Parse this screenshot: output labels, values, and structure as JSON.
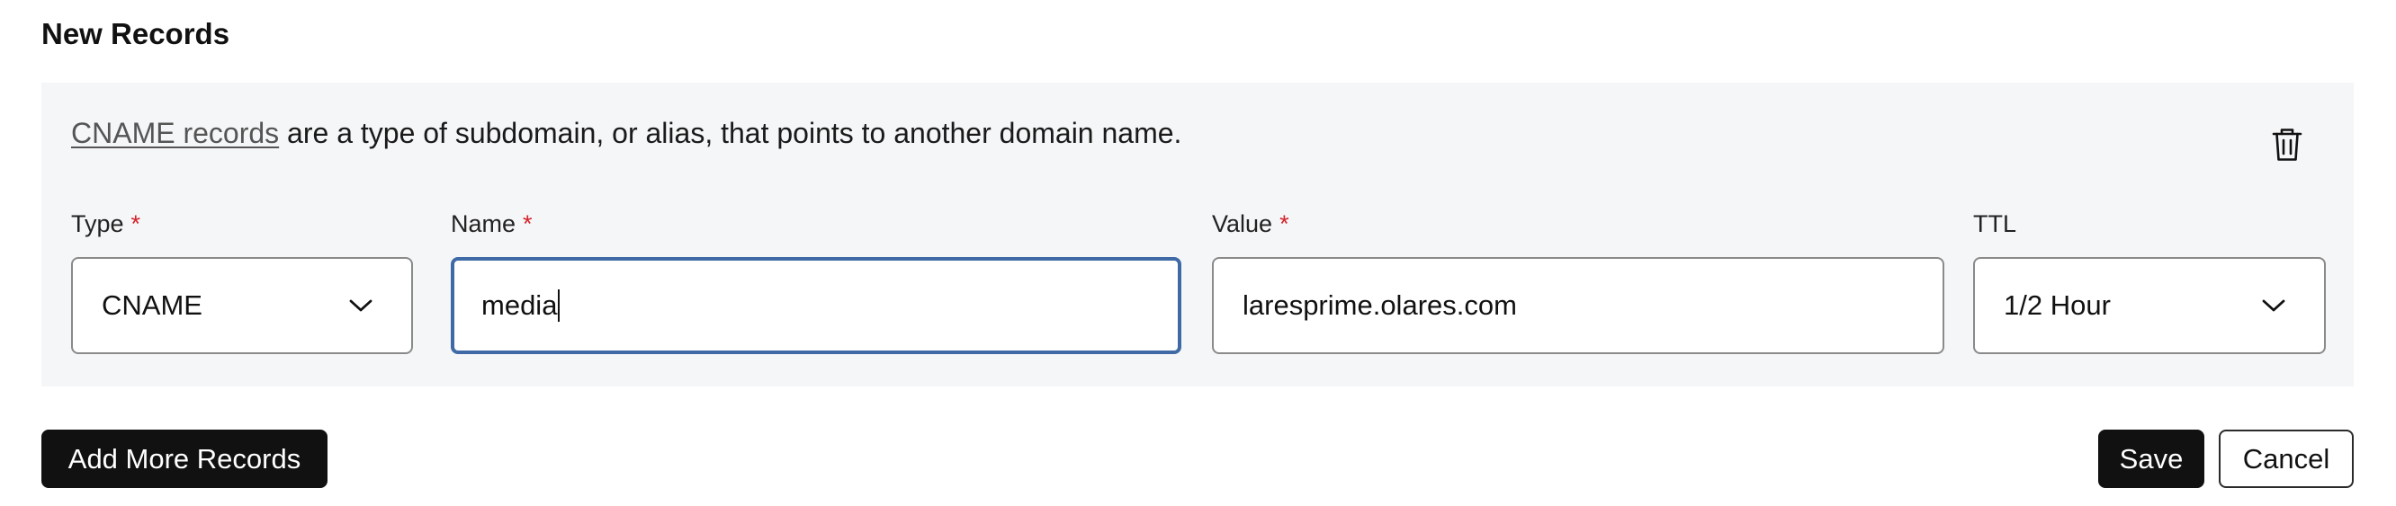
{
  "section": {
    "title": "New Records"
  },
  "record": {
    "info_link": "CNAME records",
    "info_text": " are a type of subdomain, or alias, that points to another domain name.",
    "delete_icon": "trash-icon",
    "fields": {
      "type": {
        "label": "Type",
        "required_mark": "*",
        "value": "CNAME",
        "icon": "chevron-down-icon"
      },
      "name": {
        "label": "Name",
        "required_mark": "*",
        "value": "media"
      },
      "value": {
        "label": "Value",
        "required_mark": "*",
        "value": "laresprime.olares.com"
      },
      "ttl": {
        "label": "TTL",
        "value": "1/2 Hour",
        "icon": "chevron-down-icon"
      }
    }
  },
  "actions": {
    "add_more_label": "Add More Records",
    "save_label": "Save",
    "cancel_label": "Cancel"
  },
  "colors": {
    "panel_bg": "#f5f6f8",
    "focus_border": "#3f6aa5",
    "required": "#d4232b",
    "primary_button": "#111111"
  }
}
